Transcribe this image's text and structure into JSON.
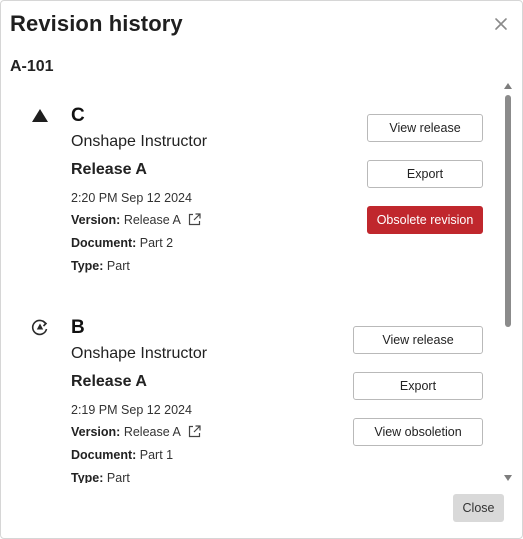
{
  "dialog": {
    "title": "Revision history",
    "part_number": "A-101",
    "close_button_label": "Close"
  },
  "revisions": [
    {
      "letter": "C",
      "icon": "triangle-icon",
      "user": "Onshape Instructor",
      "release": "Release A",
      "timestamp": "2:20 PM Sep 12 2024",
      "version_label": "Version:",
      "version_value": "Release A",
      "document_label": "Document:",
      "document_value": "Part 2",
      "type_label": "Type:",
      "type_value": "Part",
      "buttons": [
        "View release",
        "Export",
        "Obsolete revision"
      ]
    },
    {
      "letter": "B",
      "icon": "obsolete-revision-icon",
      "user": "Onshape Instructor",
      "release": "Release A",
      "timestamp": "2:19 PM Sep 12 2024",
      "version_label": "Version:",
      "version_value": "Release A",
      "document_label": "Document:",
      "document_value": "Part 1",
      "type_label": "Type:",
      "type_value": "Part",
      "buttons": [
        "View release",
        "Export",
        "View obsoletion"
      ]
    }
  ],
  "colors": {
    "danger": "#c0272d",
    "close_button_bg": "#d9d9d9"
  }
}
